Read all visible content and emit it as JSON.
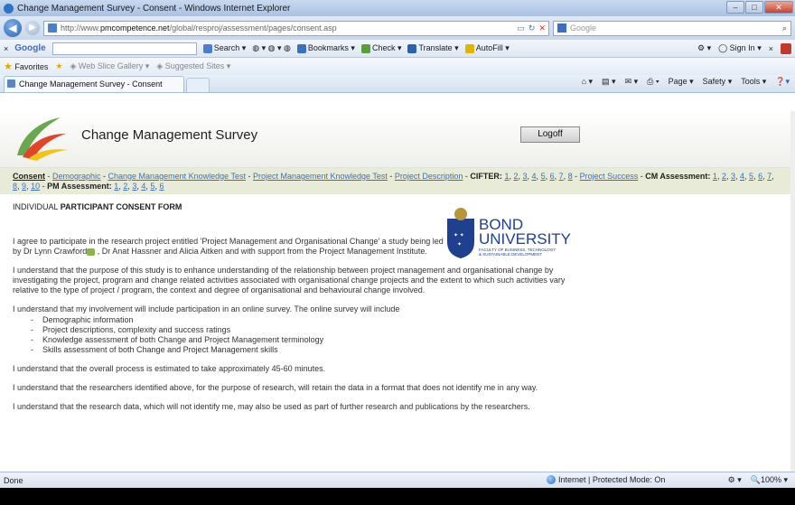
{
  "window": {
    "title": "Change Management Survey - Consent - Windows Internet Explorer"
  },
  "address": {
    "url_prefix": "http://www.",
    "url_domain": "pmcompetence.net",
    "url_path": "/global/resproj/assessment/pages/consent.asp",
    "search_placeholder": "Google"
  },
  "toolbar": {
    "brand": "Google",
    "search": "Search",
    "bookmarks": "Bookmarks",
    "check": "Check",
    "translate": "Translate",
    "autofill": "AutoFill",
    "signin": "Sign In"
  },
  "favbar": {
    "favorites": "Favorites",
    "web_slice": "Web Slice Gallery",
    "suggested": "Suggested Sites"
  },
  "tab": {
    "label": "Change Management Survey - Consent"
  },
  "commandbar": {
    "page": "Page",
    "safety": "Safety",
    "tools": "Tools"
  },
  "header": {
    "title": "Change Management Survey",
    "logoff": "Logoff"
  },
  "nav": {
    "consent": "Consent",
    "links1": [
      "Demographic",
      "Change Management Knowledge Test",
      "Project Management Knowledge Test",
      "Project Description"
    ],
    "cifter_label": "CIFTER:",
    "cifter": [
      "1",
      "2",
      "3",
      "4",
      "5",
      "6",
      "7",
      "8"
    ],
    "project_success": "Project Success",
    "cm_label": "CM Assessment:",
    "cm": [
      "1",
      "2",
      "3",
      "4",
      "5",
      "6",
      "7",
      "8",
      "9",
      "10"
    ],
    "pm_label": "PM Assessment:",
    "pm": [
      "1",
      "2",
      "3",
      "4",
      "5",
      "6"
    ]
  },
  "bond": {
    "line1": "BOND",
    "line2": "UNIVERSITY",
    "line3": "FACULTY OF BUSINESS, TECHNOLOGY",
    "line4": "& SUSTAINABLE DEVELOPMENT"
  },
  "form": {
    "title_prefix": "INDIVIDUAL ",
    "title_bold": "PARTICIPANT CONSENT FORM",
    "p1a": "I agree to participate in the research project entitled 'Project Management and Organisational Change' a study being led by Dr Lynn Crawford",
    "p1b": " , Dr Anat Hassner and Alicia Aitken and with support from the Project Management Institute.",
    "p2": "I understand that the purpose of this study is to enhance understanding of the relationship between project management and organisational change by investigating the project, program and change related activities associated with organisational change projects and the extent to which such activities vary relative to the type of project / program, the context and degree of organisational and behavioural change involved.",
    "p3": "I understand that my involvement will include participation in an online survey. The online survey will include",
    "list": [
      "Demographic information",
      "Project descriptions, complexity and success ratings",
      "Knowledge assessment of both Change and Project Management terminology",
      "Skills assessment of both Change and Project Management skills"
    ],
    "p4": "I understand that the overall process is estimated to take approximately 45-60 minutes.",
    "p5": "I understand that the researchers identified above, for the purpose of research, will retain the data in a format that does not identify me in any way.",
    "p6": "I understand that the research data, which will not identify me, may also be used as part of further research and publications by the researchers."
  },
  "status": {
    "left": "Done",
    "zone": "Internet | Protected Mode: On",
    "zoom": "100%"
  }
}
